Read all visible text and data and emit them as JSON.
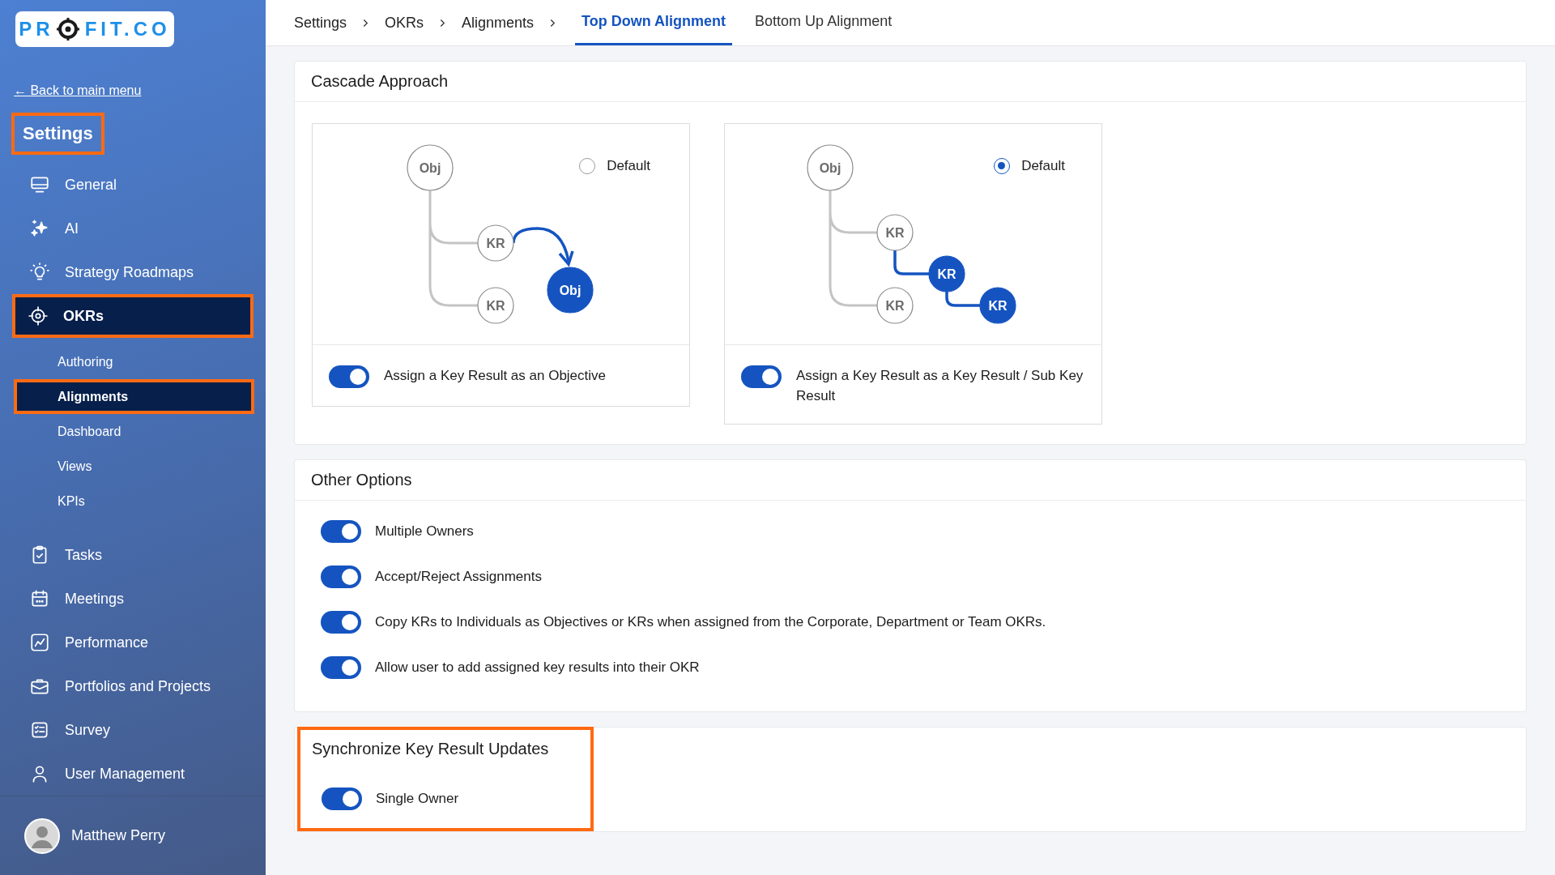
{
  "logo": {
    "before": "PR",
    "after": "FIT.CO"
  },
  "back_link": "← Back to main menu",
  "sidebar": {
    "title": {
      "text": "Settings",
      "highlighted": true
    },
    "items": [
      {
        "label": "General",
        "selected": false,
        "highlighted": false
      },
      {
        "label": "AI",
        "selected": false,
        "highlighted": false
      },
      {
        "label": "Strategy Roadmaps",
        "selected": false,
        "highlighted": false
      },
      {
        "label": "OKRs",
        "selected": true,
        "highlighted": true,
        "children": [
          {
            "label": "Authoring",
            "selected": false,
            "highlighted": false
          },
          {
            "label": "Alignments",
            "selected": true,
            "highlighted": true
          },
          {
            "label": "Dashboard",
            "selected": false,
            "highlighted": false
          },
          {
            "label": "Views",
            "selected": false,
            "highlighted": false
          },
          {
            "label": "KPIs",
            "selected": false,
            "highlighted": false
          }
        ]
      },
      {
        "label": "Tasks",
        "selected": false,
        "highlighted": false
      },
      {
        "label": "Meetings",
        "selected": false,
        "highlighted": false
      },
      {
        "label": "Performance",
        "selected": false,
        "highlighted": false
      },
      {
        "label": "Portfolios and Projects",
        "selected": false,
        "highlighted": false
      },
      {
        "label": "Survey",
        "selected": false,
        "highlighted": false
      },
      {
        "label": "User Management",
        "selected": false,
        "highlighted": false
      }
    ]
  },
  "user": {
    "name": "Matthew Perry"
  },
  "breadcrumb": [
    "Settings",
    "OKRs",
    "Alignments"
  ],
  "tabs": [
    {
      "label": "Top Down Alignment",
      "selected": true
    },
    {
      "label": "Bottom Up Alignment",
      "selected": false
    }
  ],
  "cascade": {
    "title": "Cascade Approach",
    "options": [
      {
        "kind": "objective",
        "radio_label": "Default",
        "selected": false,
        "toggle_label": "Assign a Key Result as an Objective",
        "on": true,
        "nodes": [
          {
            "label": "Obj",
            "filled": false
          },
          {
            "label": "KR",
            "filled": false
          },
          {
            "label": "KR",
            "filled": false
          },
          {
            "label": "Obj",
            "filled": true
          }
        ]
      },
      {
        "kind": "key-result",
        "radio_label": "Default",
        "selected": true,
        "toggle_label": "Assign a Key Result as a Key Result / Sub Key Result",
        "on": true,
        "nodes": [
          {
            "label": "Obj",
            "filled": false
          },
          {
            "label": "KR",
            "filled": false
          },
          {
            "label": "KR",
            "filled": false
          },
          {
            "label": "KR",
            "filled": true
          },
          {
            "label": "KR",
            "filled": true
          }
        ]
      }
    ]
  },
  "other_options": {
    "title": "Other Options",
    "toggles": [
      {
        "label": "Multiple Owners",
        "on": true
      },
      {
        "label": "Accept/Reject Assignments",
        "on": true
      },
      {
        "label": "Copy KRs to Individuals as Objectives or KRs when assigned from the Corporate, Department or Team OKRs.",
        "on": true
      },
      {
        "label": "Allow user to add assigned key results into their OKR",
        "on": true
      }
    ]
  },
  "sync": {
    "title": "Synchronize Key Result Updates",
    "highlighted": true,
    "toggles": [
      {
        "label": "Single Owner",
        "on": true
      }
    ]
  }
}
